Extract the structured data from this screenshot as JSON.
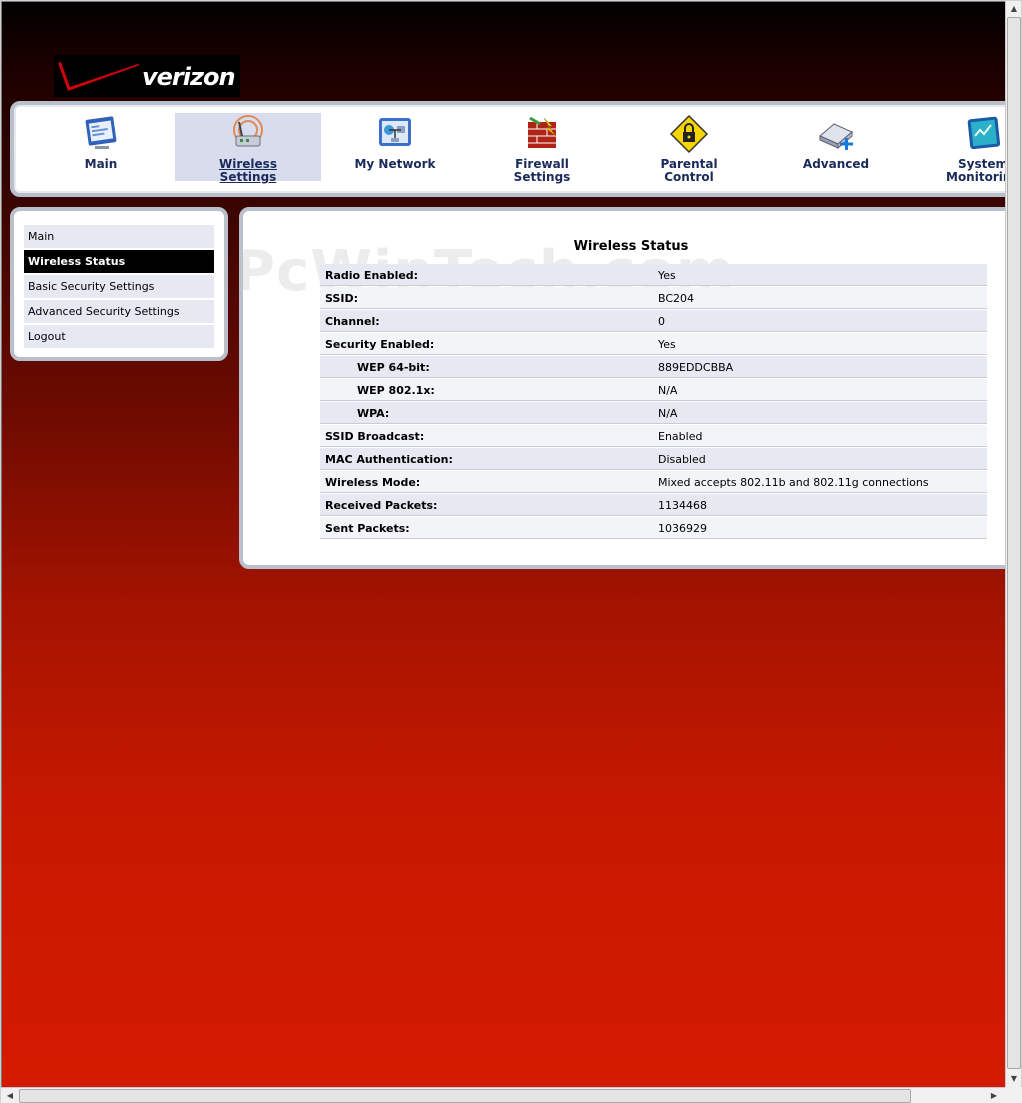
{
  "brand": {
    "logo_text": "verizon"
  },
  "nav": {
    "items": [
      {
        "label_line1": "Main",
        "label_line2": "",
        "icon": "monitor-icon"
      },
      {
        "label_line1": "Wireless",
        "label_line2": "Settings",
        "icon": "wireless-router-icon"
      },
      {
        "label_line1": "My Network",
        "label_line2": "",
        "icon": "network-icon"
      },
      {
        "label_line1": "Firewall",
        "label_line2": "Settings",
        "icon": "firewall-icon"
      },
      {
        "label_line1": "Parental",
        "label_line2": "Control",
        "icon": "lock-icon"
      },
      {
        "label_line1": "Advanced",
        "label_line2": "",
        "icon": "advanced-icon"
      },
      {
        "label_line1": "System",
        "label_line2": "Monitoring",
        "icon": "system-monitor-icon"
      }
    ],
    "active_index": 1
  },
  "sidebar": {
    "items": [
      {
        "label": "Main"
      },
      {
        "label": "Wireless Status"
      },
      {
        "label": "Basic Security Settings"
      },
      {
        "label": "Advanced Security Settings"
      },
      {
        "label": "Logout"
      }
    ],
    "active_index": 1
  },
  "content": {
    "title": "Wireless Status",
    "watermark": "PcWinTech.com",
    "rows": [
      {
        "key": "Radio Enabled:",
        "value": "Yes"
      },
      {
        "key": "SSID:",
        "value": "BC204"
      },
      {
        "key": "Channel:",
        "value": "0"
      },
      {
        "key": "Security Enabled:",
        "value": "Yes"
      },
      {
        "key": "WEP 64-bit:",
        "value": "889EDDCBBA"
      },
      {
        "key": "WEP 802.1x:",
        "value": "N/A"
      },
      {
        "key": "WPA:",
        "value": "N/A"
      },
      {
        "key": "SSID Broadcast:",
        "value": "Enabled"
      },
      {
        "key": "MAC Authentication:",
        "value": "Disabled"
      },
      {
        "key": "Wireless Mode:",
        "value": "Mixed accepts 802.11b and 802.11g connections"
      },
      {
        "key": "Received Packets:",
        "value": "1134468"
      },
      {
        "key": "Sent Packets:",
        "value": "1036929"
      }
    ]
  },
  "colors": {
    "brand_red": "#cd040b",
    "nav_active": "#d8dcec",
    "row_shade": "#e6e9f2"
  }
}
